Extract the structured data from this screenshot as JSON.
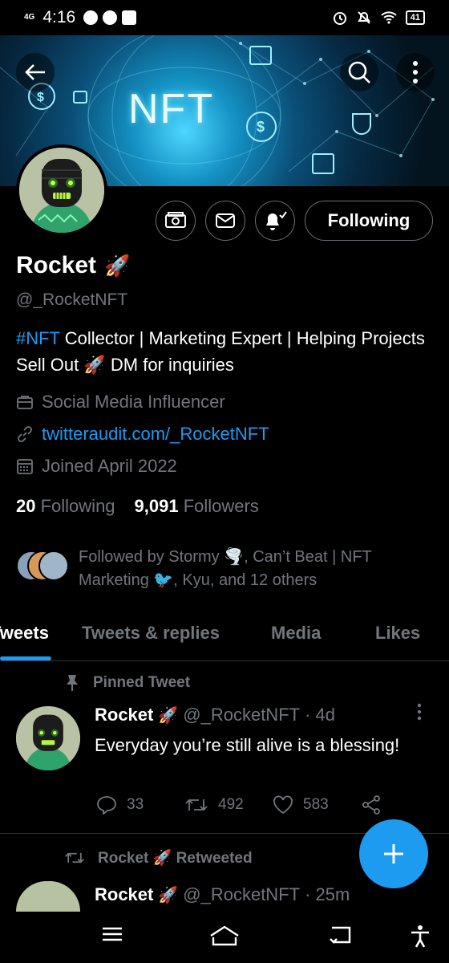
{
  "status_bar": {
    "network": "4G",
    "time": "4:16",
    "battery": "41"
  },
  "banner": {
    "text": "NFT"
  },
  "profile": {
    "name": "Rocket",
    "handle": "@_RocketNFT",
    "follow_button": "Following",
    "bio_hashtag": "#NFT",
    "bio_rest": " Collector | Marketing Expert | Helping Projects Sell Out 🚀 DM for inquiries",
    "category": "Social Media Influencer",
    "link": "twitteraudit.com/_RocketNFT",
    "joined": "Joined April 2022",
    "following_count": "20",
    "following_label": "Following",
    "followers_count": "9,091",
    "followers_label": "Followers",
    "followed_by": "Followed by Stormy 🌪️, Can’t Beat | NFT Marketing 🐦, Kyu, and 12 others"
  },
  "tabs": [
    {
      "label": "Tweets"
    },
    {
      "label": "Tweets & replies"
    },
    {
      "label": "Media"
    },
    {
      "label": "Likes"
    }
  ],
  "tweets": [
    {
      "context": "Pinned Tweet",
      "name": "Rocket",
      "handle": "@_RocketNFT",
      "time": "· 4d",
      "text": "Everyday you’re still alive is a blessing!",
      "replies": "33",
      "retweets": "492",
      "likes": "583"
    },
    {
      "context": "Rocket 🚀 Retweeted",
      "name": "Rocket",
      "handle": "@_RocketNFT",
      "time": "· 25m"
    }
  ],
  "colors": {
    "accent": "#1d9bf0",
    "muted": "#71767b",
    "background": "#000000"
  },
  "icons": [
    "back-arrow-icon",
    "search-icon",
    "more-icon",
    "tip-jar-icon",
    "mail-icon",
    "bell-plus-icon",
    "briefcase-icon",
    "link-icon",
    "calendar-icon",
    "pin-icon",
    "reply-icon",
    "retweet-icon",
    "heart-icon",
    "share-icon",
    "compose-plus-icon"
  ]
}
